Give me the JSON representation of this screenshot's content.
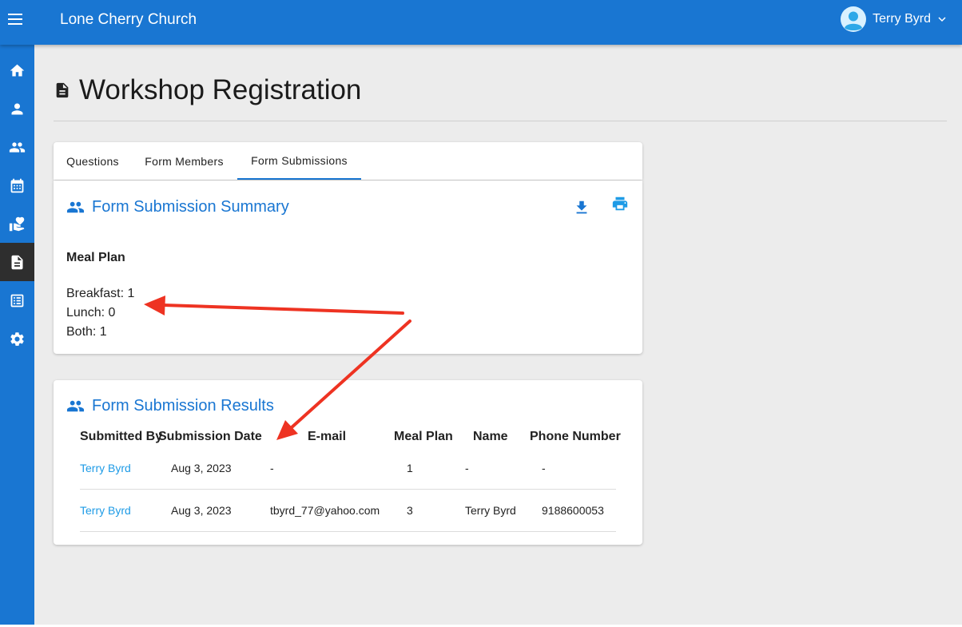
{
  "app": {
    "church_name": "Lone Cherry Church",
    "user_name": "Terry Byrd"
  },
  "sidebar": {
    "items": [
      {
        "icon": "home-icon"
      },
      {
        "icon": "person-icon"
      },
      {
        "icon": "people-icon"
      },
      {
        "icon": "calendar-icon"
      },
      {
        "icon": "donations-icon"
      },
      {
        "icon": "forms-icon",
        "active": true
      },
      {
        "icon": "list-icon"
      },
      {
        "icon": "settings-icon"
      }
    ]
  },
  "page": {
    "title": "Workshop Registration"
  },
  "tabs": [
    {
      "label": "Questions"
    },
    {
      "label": "Form Members"
    },
    {
      "label": "Form Submissions",
      "active": true
    }
  ],
  "summary": {
    "title": "Form Submission Summary",
    "question": "Meal Plan",
    "lines": [
      "Breakfast: 1",
      "Lunch: 0",
      "Both: 1"
    ]
  },
  "results": {
    "title": "Form Submission Results",
    "columns": [
      "Submitted By",
      "Submission Date",
      "E-mail",
      "Meal Plan",
      "Name",
      "Phone Number"
    ],
    "rows": [
      [
        "Terry Byrd",
        "Aug 3, 2023",
        "-",
        "1",
        "-",
        "-"
      ],
      [
        "Terry Byrd",
        "Aug 3, 2023",
        "tbyrd_77@yahoo.com",
        "3",
        "Terry Byrd",
        "9188600053"
      ]
    ]
  },
  "colors": {
    "primary": "#1976d2",
    "link": "#1e9be6",
    "annotation_arrow": "#ee3322",
    "active_nav": "#2e2e2e"
  }
}
